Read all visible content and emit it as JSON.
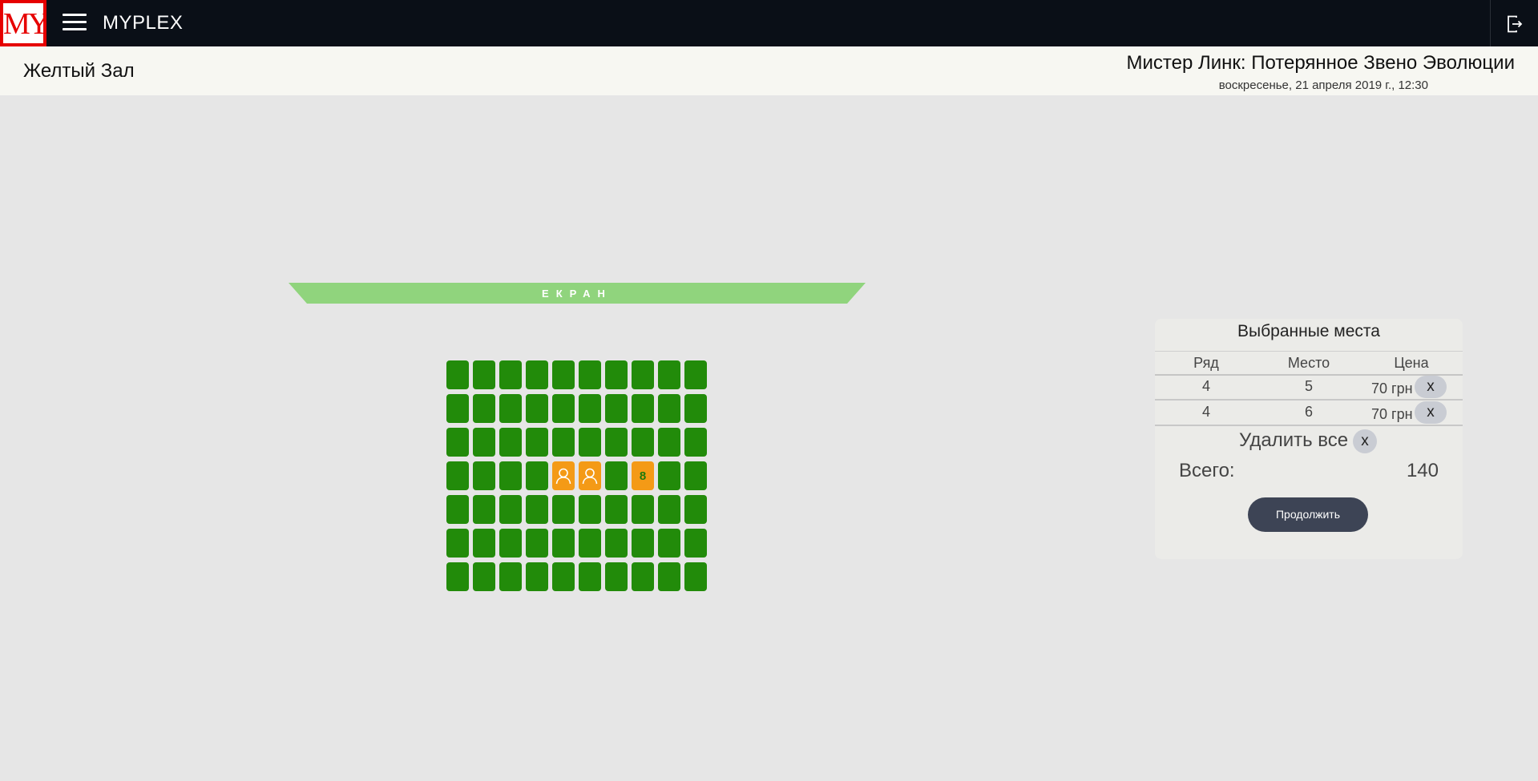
{
  "app": {
    "logo_text": "MY",
    "brand": "MYPLEX",
    "menu_icon": "hamburger-menu-icon",
    "logout_icon": "logout-icon"
  },
  "session": {
    "hall": "Желтый Зал",
    "movie_title": "Мистер Линк: Потерянное Звено Эволюции",
    "date": "воскресенье, 21 апреля 2019 г., 12:30"
  },
  "screen": {
    "label": "ЕКРАН",
    "color": "#90d47d"
  },
  "seat_map": {
    "rows": 7,
    "seats_per_row": 10,
    "free_color": "#228b0a",
    "selected_color": "#f49a16",
    "selected": [
      {
        "row": 4,
        "seat": 5
      },
      {
        "row": 4,
        "seat": 6
      }
    ],
    "hovered": {
      "row": 4,
      "seat": 8,
      "label": "8"
    }
  },
  "panel": {
    "title": "Выбранные места",
    "headers": {
      "row": "Ряд",
      "seat": "Место",
      "price": "Цена"
    },
    "tickets": [
      {
        "row": "4",
        "seat": "5",
        "price": "70 грн",
        "remove": "x"
      },
      {
        "row": "4",
        "seat": "6",
        "price": "70 грн",
        "remove": "x"
      }
    ],
    "clear_all_label": "Удалить все",
    "clear_all_button": "x",
    "total_label": "Всего:",
    "total_value": "140",
    "continue_label": "Продолжить"
  }
}
